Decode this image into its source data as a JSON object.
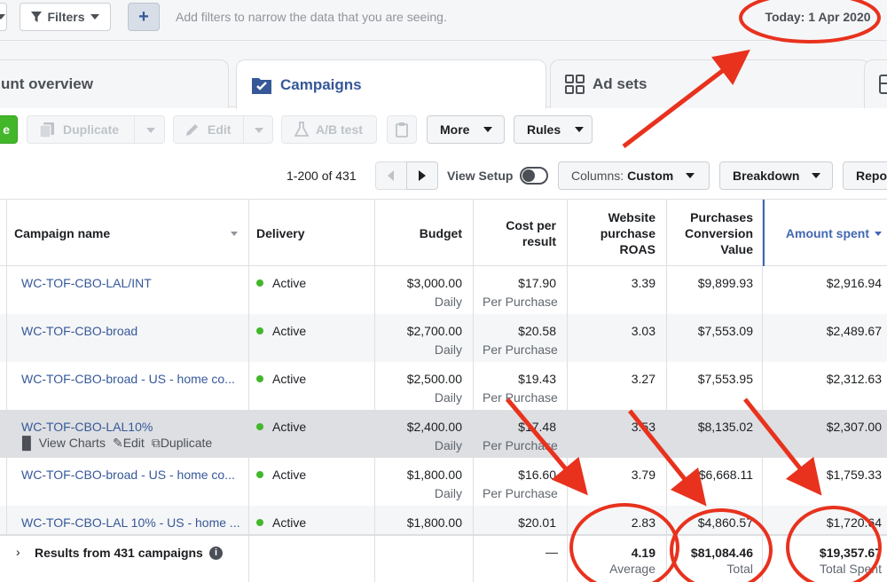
{
  "filterbar": {
    "filters_label": "Filters",
    "add_label": "+",
    "hint": "Add filters to narrow the data that you are seeing.",
    "today": "Today: 1 Apr 2020"
  },
  "tabs": [
    {
      "label": "unt overview",
      "icon": "overview-icon"
    },
    {
      "label": "Campaigns",
      "icon": "folder-check-icon"
    },
    {
      "label": "Ad sets",
      "icon": "grid-icon"
    }
  ],
  "toolbar": {
    "create_label": "e",
    "duplicate_label": "Duplicate",
    "edit_label": "Edit",
    "abtest_label": "A/B test",
    "more_label": "More",
    "rules_label": "Rules"
  },
  "pager": {
    "range": "1-200 of 431",
    "view_setup": "View Setup",
    "columns_prefix": "Columns:",
    "columns_value": "Custom",
    "breakdown": "Breakdown",
    "reports": "Repor"
  },
  "table": {
    "headers": {
      "name": "Campaign name",
      "delivery": "Delivery",
      "budget": "Budget",
      "cpr1": "Cost per",
      "cpr2": "result",
      "roas1": "Website",
      "roas2": "purchase",
      "roas3": "ROAS",
      "pcv1": "Purchases",
      "pcv2": "Conversion",
      "pcv3": "Value",
      "spent": "Amount spent"
    },
    "rows": [
      {
        "name": "WC-TOF-CBO-LAL/INT",
        "delivery": "Active",
        "budget": "$3,000.00",
        "budget_type": "Daily",
        "cpr": "$17.90",
        "cpr_type": "Per Purchase",
        "roas": "3.39",
        "pcv": "$9,899.93",
        "spent": "$2,916.94"
      },
      {
        "name": "WC-TOF-CBO-broad",
        "delivery": "Active",
        "budget": "$2,700.00",
        "budget_type": "Daily",
        "cpr": "$20.58",
        "cpr_type": "Per Purchase",
        "roas": "3.03",
        "pcv": "$7,553.09",
        "spent": "$2,489.67"
      },
      {
        "name": "WC-TOF-CBO-broad - US - home co...",
        "delivery": "Active",
        "budget": "$2,500.00",
        "budget_type": "Daily",
        "cpr": "$19.43",
        "cpr_type": "Per Purchase",
        "roas": "3.27",
        "pcv": "$7,553.95",
        "spent": "$2,312.63"
      },
      {
        "name": "WC-TOF-CBO-LAL10%",
        "delivery": "Active",
        "budget": "$2,400.00",
        "budget_type": "Daily",
        "cpr": "$17.48",
        "cpr_type": "Per Purchase",
        "roas": "3.53",
        "pcv": "$8,135.02",
        "spent": "$2,307.00",
        "actions": {
          "charts": "View Charts",
          "edit": "Edit",
          "duplicate": "Duplicate"
        }
      },
      {
        "name": "WC-TOF-CBO-broad - US - home co...",
        "delivery": "Active",
        "budget": "$1,800.00",
        "budget_type": "Daily",
        "cpr": "$16.60",
        "cpr_type": "Per Purchase",
        "roas": "3.79",
        "pcv": "$6,668.11",
        "spent": "$1,759.33"
      },
      {
        "name": "WC-TOF-CBO-LAL 10% - US - home ...",
        "delivery": "Active",
        "budget": "$1,800.00",
        "budget_type": "",
        "cpr": "$20.01",
        "cpr_type": "",
        "roas": "2.83",
        "pcv": "$4,860.57",
        "spent": "$1,720.64"
      }
    ],
    "footer": {
      "label": "Results from 431 campaigns",
      "cpr": "—",
      "roas": "4.19",
      "roas_sub": "Average",
      "pcv": "$81,084.46",
      "pcv_sub": "Total",
      "spent": "$19,357.67",
      "spent_sub": "Total Spent"
    }
  },
  "colors": {
    "accent": "#365899",
    "active": "#42b72a",
    "annotation": "#e8321e"
  }
}
